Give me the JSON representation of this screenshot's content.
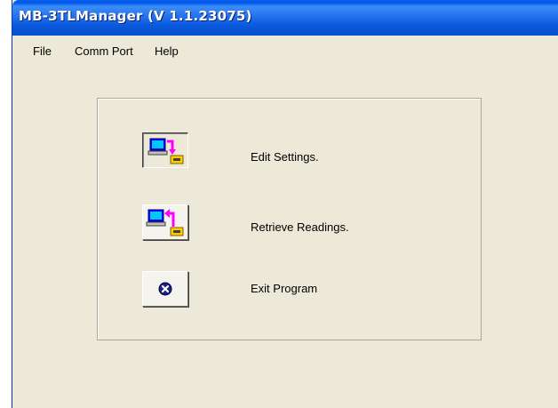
{
  "window": {
    "title": "MB-3TLManager (V 1.1.23075)"
  },
  "menu": {
    "items": [
      {
        "label": "File"
      },
      {
        "label": "Comm Port"
      },
      {
        "label": "Help"
      }
    ]
  },
  "actions": [
    {
      "label": "Edit Settings.",
      "icon": "computer-to-device-icon"
    },
    {
      "label": "Retrieve Readings.",
      "icon": "device-to-computer-icon"
    },
    {
      "label": "Exit Program",
      "icon": "close-circle-icon"
    }
  ],
  "colors": {
    "titlebar": "#0a5ee8",
    "window_bg": "#ece9d8",
    "arrow": "#ff00ff",
    "monitor": "#0000ff",
    "device": "#ffcc00"
  }
}
